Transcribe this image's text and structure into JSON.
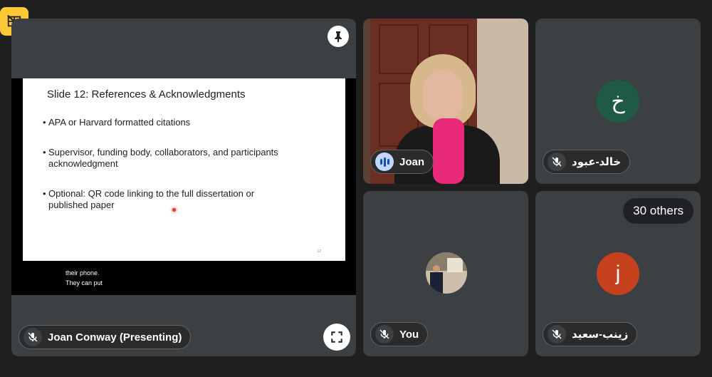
{
  "colors": {
    "background": "#202124",
    "tile": "#3c4043",
    "layout_button": "#fcc934",
    "avatar_khalid": "#1e5a45",
    "avatar_j": "#c5401c",
    "scarf": "#e8297a"
  },
  "layout_button": {
    "icon": "no-video-grid-icon"
  },
  "presentation": {
    "presenter_label": "Joan Conway (Presenting)",
    "pin_icon": "pin-icon",
    "fullscreen_icon": "fullscreen-icon",
    "slide": {
      "title": "Slide 12: References & Acknowledgments",
      "bullets": [
        "APA or Harvard formatted citations",
        "Supervisor, funding body, collaborators, and participants acknowledgment",
        "Optional: QR code linking to the full dissertation or published paper"
      ],
      "page_number": "12"
    },
    "captions": [
      "their phone.",
      "They can put"
    ]
  },
  "participants": {
    "joan": {
      "name": "Joan",
      "status_icon": "speaking-icon"
    },
    "khalid": {
      "name": "خالد-عبود",
      "initial": "خ",
      "status_icon": "mic-off-icon"
    },
    "you": {
      "name": "You",
      "status_icon": "mic-off-icon"
    },
    "others": {
      "count_label": "30 others",
      "name": "زينب-سعيد",
      "initial": "j",
      "status_icon": "mic-off-icon"
    }
  }
}
